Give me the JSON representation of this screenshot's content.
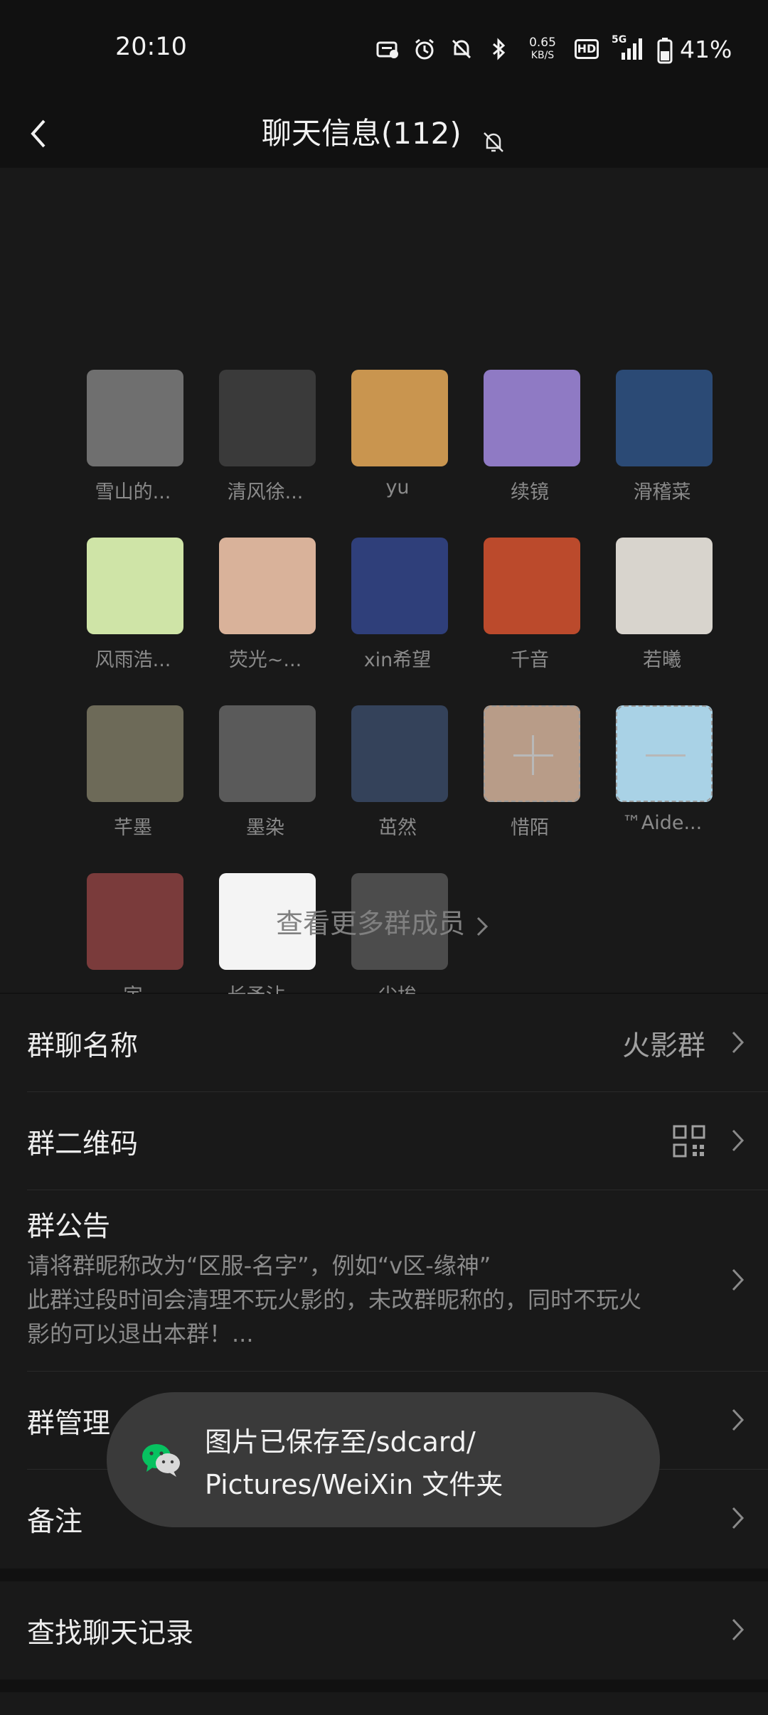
{
  "status_bar": {
    "time": "20:10",
    "net_speed_value": "0.65",
    "net_speed_unit": "KB/S",
    "hd": "HD",
    "signal": "5G",
    "battery": "41%"
  },
  "header": {
    "title": "聊天信息(112)"
  },
  "members": [
    {
      "name": "雪山的...",
      "color": "#6f6f6f"
    },
    {
      "name": "清风徐...",
      "color": "#3a3a3a"
    },
    {
      "name": "yu",
      "color": "#c9954f"
    },
    {
      "name": "续镜",
      "color": "#8f7ac4"
    },
    {
      "name": "滑稽菜",
      "color": "#2b4a75"
    },
    {
      "name": "风雨浩...",
      "color": "#cfe4a7"
    },
    {
      "name": "荧光~...",
      "color": "#d9b29a"
    },
    {
      "name": "xin希望",
      "color": "#2f3f7a"
    },
    {
      "name": "千音",
      "color": "#bb4a2c"
    },
    {
      "name": "若曦",
      "color": "#d8d4cd"
    },
    {
      "name": "芊墨",
      "color": "#6d6a58"
    },
    {
      "name": "墨染",
      "color": "#5a5a5a"
    },
    {
      "name": "茁然",
      "color": "#34425a"
    },
    {
      "name": "惜陌",
      "color": "#b89c88"
    },
    {
      "name": "™Aide...",
      "color": "#a9d2e6"
    },
    {
      "name": "宇",
      "color": "#7a3b3b"
    },
    {
      "name": "长矛沾...",
      "color": "#f4f4f4"
    },
    {
      "name": "尘埃",
      "color": "#4c4c4c"
    }
  ],
  "more_members": "查看更多群成员",
  "settings": {
    "group_name_label": "群聊名称",
    "group_name_value": "火影群",
    "qr_label": "群二维码",
    "notice_label": "群公告",
    "notice_line1": "请将群昵称改为“区服-名字”，例如“v区-缘神”",
    "notice_line2": "此群过段时间会清理不玩火影的，未改群昵称的，同时不玩火",
    "notice_line3": "影的可以退出本群！...",
    "manage_label": "群管理",
    "remark_label": "备注",
    "search_label": "查找聊天记录"
  },
  "toast": {
    "line1": "图片已保存至/sdcard/",
    "line2": "Pictures/WeiXin 文件夹"
  },
  "colors": {
    "background": "#111111",
    "panel": "#191919",
    "wechat_green": "#07c160"
  }
}
